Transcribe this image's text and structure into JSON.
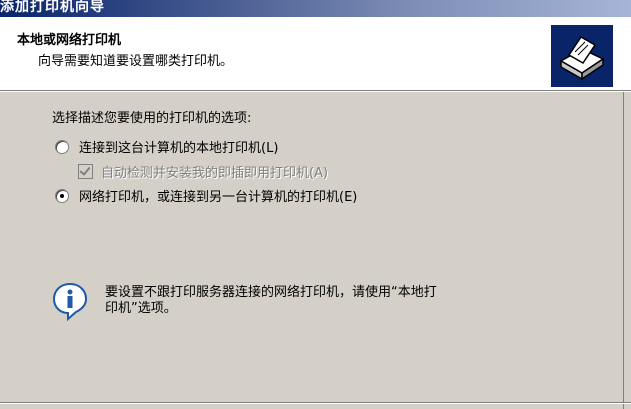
{
  "window": {
    "title": "添加打印机向导"
  },
  "header": {
    "title": "本地或网络打印机",
    "subtitle": "向导需要知道要设置哪类打印机。",
    "icon": "printer-wizard-icon"
  },
  "main": {
    "prompt": "选择描述您要使用的打印机的选项:",
    "options": [
      {
        "label": "连接到这台计算机的本地打印机(L)",
        "selected": false
      },
      {
        "label": "网络打印机，或连接到另一台计算机的打印机(E)",
        "selected": true
      }
    ],
    "auto_detect": {
      "label": "自动检测并安装我的即插即用打印机(A)",
      "checked": true,
      "enabled": false
    },
    "info": {
      "icon": "info-icon",
      "line1": "要设置不跟打印服务器连接的网络打印机，请使用“本地打",
      "line2": "印机”选项。"
    }
  },
  "colors": {
    "dialog_bg": "#d4d0c8",
    "header_bg": "#ffffff",
    "titlebar_start": "#0a246a",
    "icon_bg": "#0a246a",
    "disabled_text": "#808080"
  }
}
